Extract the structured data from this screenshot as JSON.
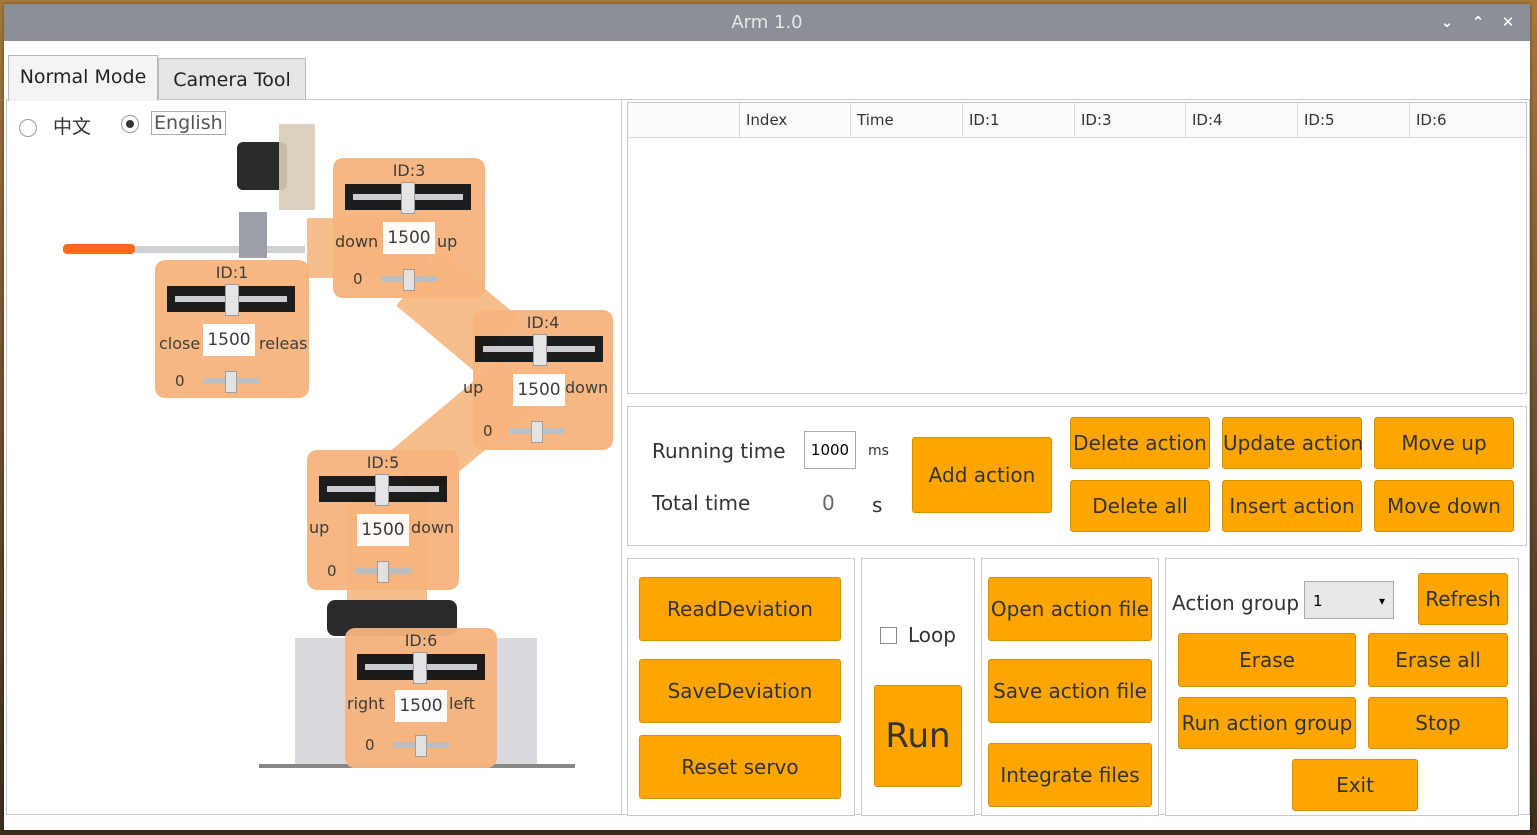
{
  "window": {
    "title": "Arm 1.0",
    "controls": [
      "⌄",
      "⌃",
      "✕"
    ]
  },
  "tabs": [
    {
      "label": "Normal Mode",
      "active": true
    },
    {
      "label": "Camera Tool",
      "active": false
    }
  ],
  "language": {
    "option_cn": "中文",
    "option_en": "English",
    "selected": "English"
  },
  "servos": [
    {
      "id": "ID:1",
      "value": "1500",
      "left_label": "close",
      "right_label": "releas",
      "deviation": "0"
    },
    {
      "id": "ID:3",
      "value": "1500",
      "left_label": "down",
      "right_label": "up",
      "deviation": "0"
    },
    {
      "id": "ID:4",
      "value": "1500",
      "left_label": "up",
      "right_label": "down",
      "deviation": "0"
    },
    {
      "id": "ID:5",
      "value": "1500",
      "left_label": "up",
      "right_label": "down",
      "deviation": "0"
    },
    {
      "id": "ID:6",
      "value": "1500",
      "left_label": "right",
      "right_label": "left",
      "deviation": "0"
    }
  ],
  "table": {
    "columns": [
      "",
      "Index",
      "Time",
      "ID:1",
      "ID:3",
      "ID:4",
      "ID:5",
      "ID:6"
    ]
  },
  "timing": {
    "running_label": "Running time",
    "running_value": "1000",
    "running_unit": "ms",
    "total_label": "Total time",
    "total_value": "0",
    "total_unit": "s"
  },
  "actions": {
    "add": "Add action",
    "delete": "Delete action",
    "update": "Update action",
    "move_up": "Move up",
    "delete_all": "Delete all",
    "insert": "Insert action",
    "move_down": "Move down"
  },
  "deviation": {
    "read": "ReadDeviation",
    "save": "SaveDeviation",
    "reset": "Reset servo"
  },
  "run": {
    "loop_label": "Loop",
    "run_label": "Run"
  },
  "files": {
    "open": "Open action file",
    "save": "Save action file",
    "integrate": "Integrate files"
  },
  "action_group": {
    "label": "Action group",
    "selected": "1",
    "refresh": "Refresh",
    "erase": "Erase",
    "erase_all": "Erase all",
    "run": "Run action group",
    "stop": "Stop",
    "exit": "Exit"
  },
  "colors": {
    "accent": "#ffa500",
    "titlebar": "#8a9096",
    "panel": "#f8b47c"
  }
}
